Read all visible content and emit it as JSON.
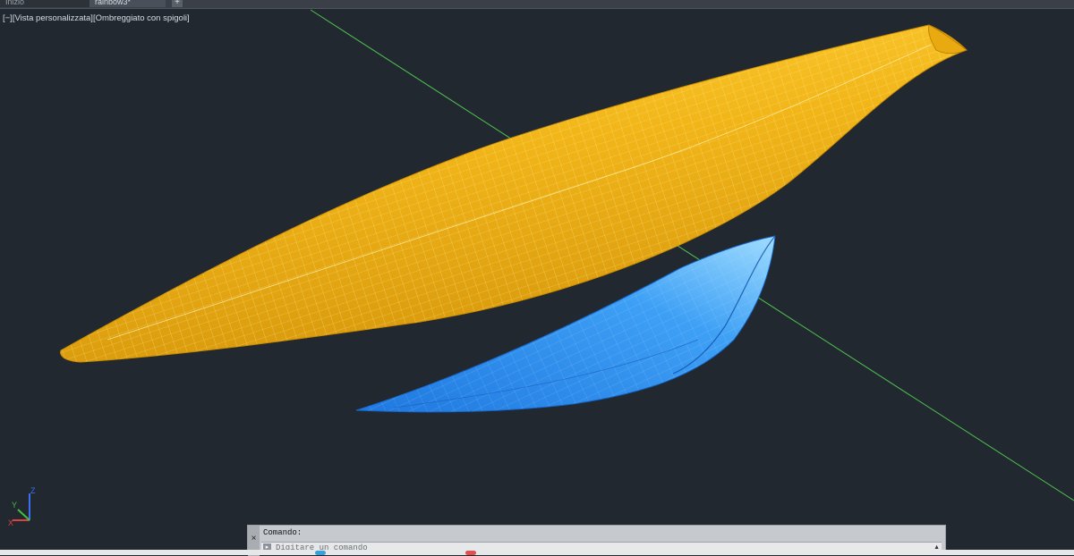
{
  "tabs": [
    {
      "label": "Inizio"
    },
    {
      "label": "rainbow3*"
    }
  ],
  "new_tab_label": "+",
  "viewport": {
    "label": "[−][Vista personalizzata][Ombreggiato con spigoli]"
  },
  "ucs_icon": {
    "x_label": "X",
    "y_label": "Y",
    "z_label": "Z"
  },
  "command_line": {
    "close_label": "×",
    "history": "Comando:",
    "placeholder": "Digitare un comando",
    "prompt_icon": "▸"
  },
  "colors": {
    "background": "#212830",
    "hull_yellow": "#f2b619",
    "hull_blue": "#2f8ff0",
    "axis_green": "#4fc04f"
  }
}
